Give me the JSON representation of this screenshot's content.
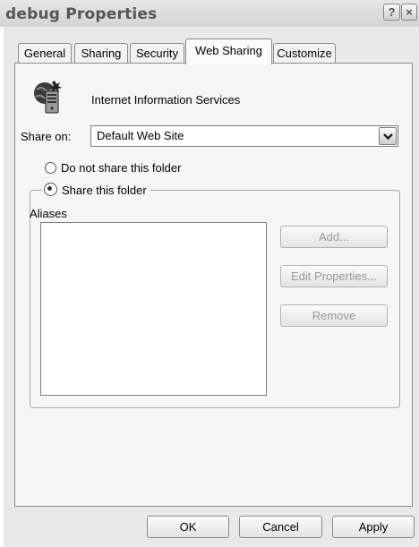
{
  "window": {
    "title": "debug Properties",
    "help_button": "?",
    "close_button": "×"
  },
  "tabs": [
    {
      "label": "General"
    },
    {
      "label": "Sharing"
    },
    {
      "label": "Security"
    },
    {
      "label": "Web Sharing",
      "active": true
    },
    {
      "label": "Customize"
    }
  ],
  "web_sharing": {
    "service_label": "Internet Information Services",
    "service_icon": "iis-globe-server-icon",
    "share_on_label": "Share on:",
    "share_on_value": "Default Web Site",
    "option_do_not_share": "Do not share this folder",
    "option_share": "Share this folder",
    "selected_option": "share",
    "aliases_label": "Aliases",
    "aliases": [],
    "buttons": {
      "add": "Add...",
      "edit": "Edit Properties...",
      "remove": "Remove"
    }
  },
  "footer": {
    "ok": "OK",
    "cancel": "Cancel",
    "apply": "Apply"
  }
}
